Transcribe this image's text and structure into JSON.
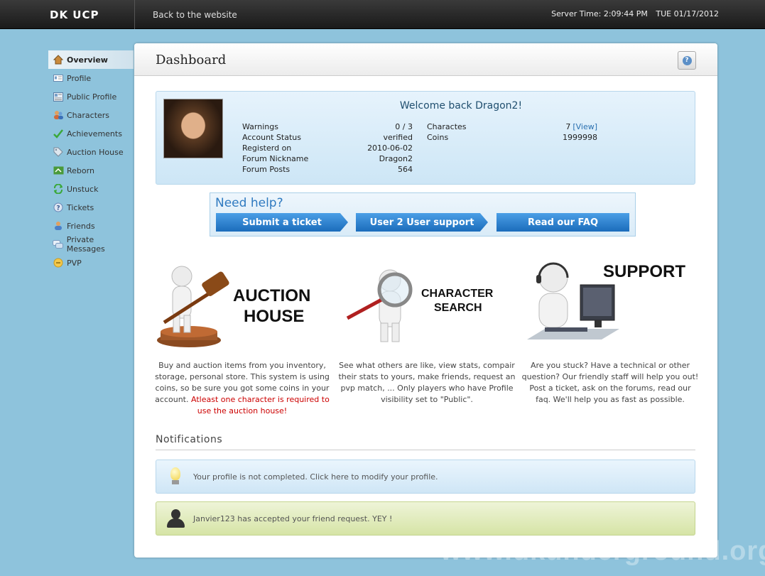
{
  "topbar": {
    "brand": "DK UCP",
    "back_link": "Back to the website",
    "server_time": "Server Time: 2:09:44 PM",
    "date": "TUE 01/17/2012"
  },
  "sidebar": {
    "items": [
      {
        "label": "Overview",
        "icon": "home-icon"
      },
      {
        "label": "Profile",
        "icon": "id-card-icon"
      },
      {
        "label": "Public Profile",
        "icon": "public-profile-icon"
      },
      {
        "label": "Characters",
        "icon": "characters-icon"
      },
      {
        "label": "Achievements",
        "icon": "checkmark-icon"
      },
      {
        "label": "Auction House",
        "icon": "tag-icon"
      },
      {
        "label": "Reborn",
        "icon": "reborn-icon"
      },
      {
        "label": "Unstuck",
        "icon": "unstuck-icon"
      },
      {
        "label": "Tickets",
        "icon": "question-icon"
      },
      {
        "label": "Friends",
        "icon": "friends-icon"
      },
      {
        "label": "Private Messages",
        "icon": "messages-icon"
      },
      {
        "label": "PVP",
        "icon": "pvp-icon"
      }
    ]
  },
  "main": {
    "title": "Dashboard",
    "welcome": {
      "title": "Welcome back Dragon2!",
      "left": [
        {
          "label": "Warnings",
          "value": "0 / 3"
        },
        {
          "label": "Account Status",
          "value": "verified"
        },
        {
          "label": "Registerd on",
          "value": "2010-06-02"
        },
        {
          "label": "Forum Nickname",
          "value": "Dragon2"
        },
        {
          "label": "Forum Posts",
          "value": "564"
        }
      ],
      "right": [
        {
          "label": "Charactes",
          "value": "7",
          "link": "[View]"
        },
        {
          "label": "Coins",
          "value": "1999998"
        }
      ]
    },
    "help": {
      "title": "Need help?",
      "buttons": [
        "Submit a ticket",
        "User 2 User support",
        "Read our FAQ"
      ]
    },
    "features": [
      {
        "heading_line1": "AUCTION",
        "heading_line2": "HOUSE",
        "desc": "Buy and auction items from you inventory, storage, personal store. This system is using coins, so be sure you got some coins in your account.",
        "warning": "Atleast one character is required to use the auction house!"
      },
      {
        "heading_line1": "CHARACTER",
        "heading_line2": "SEARCH",
        "desc": "See what others are like, view stats, compair their stats to yours, make friends, request an pvp match, ... Only players who have Profile visibility set to \"Public\"."
      },
      {
        "heading_line1": "SUPPORT",
        "desc": "Are you stuck? Have a technical or other question? Our friendly staff will help you out! Post a ticket, ask on the forums, read our faq. We'll help you as fast as possible."
      }
    ],
    "notifications_heading": "Notifications",
    "notifications": [
      {
        "text": "Your profile is not completed. Click here to modify your profile.",
        "icon": "lightbulb-icon"
      },
      {
        "text": "Janvier123 has accepted your friend request. YEY !",
        "icon": "user-icon"
      }
    ]
  },
  "watermark": "www.dkunderground.org",
  "colors": {
    "background": "#8ec3dc",
    "accent_blue": "#1b6cbb",
    "warning_red": "#cc0000"
  }
}
